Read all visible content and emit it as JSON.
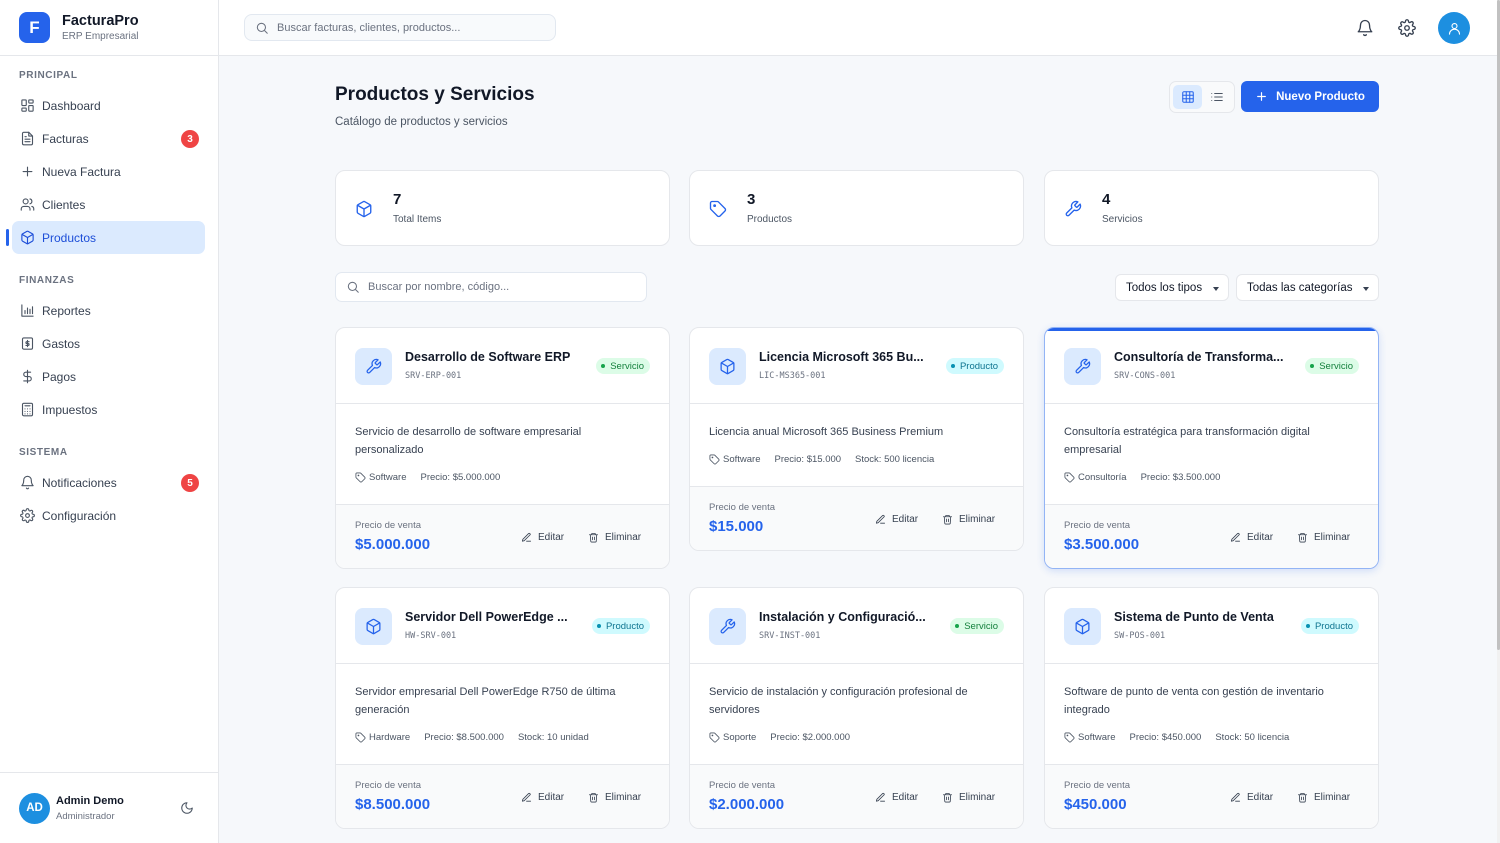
{
  "brand": {
    "logo_letter": "F",
    "name": "FacturaPro",
    "subtitle": "ERP Empresarial"
  },
  "sidebar": {
    "sections": [
      {
        "title": "PRINCIPAL",
        "items": [
          {
            "label": "Dashboard",
            "icon": "grid-icon"
          },
          {
            "label": "Facturas",
            "icon": "file-text-icon",
            "badge": "3"
          },
          {
            "label": "Nueva Factura",
            "icon": "plus-icon"
          },
          {
            "label": "Clientes",
            "icon": "users-icon"
          },
          {
            "label": "Productos",
            "icon": "package-icon",
            "active": true
          }
        ]
      },
      {
        "title": "FINANZAS",
        "items": [
          {
            "label": "Reportes",
            "icon": "bar-chart-icon"
          },
          {
            "label": "Gastos",
            "icon": "receipt-icon"
          },
          {
            "label": "Pagos",
            "icon": "dollar-icon"
          },
          {
            "label": "Impuestos",
            "icon": "calculator-icon"
          }
        ]
      },
      {
        "title": "SISTEMA",
        "items": [
          {
            "label": "Notificaciones",
            "icon": "bell-icon",
            "badge": "5"
          },
          {
            "label": "Configuración",
            "icon": "gear-icon"
          }
        ]
      }
    ],
    "user": {
      "initials": "AD",
      "name": "Admin Demo",
      "role": "Administrador"
    }
  },
  "topbar": {
    "search_placeholder": "Buscar facturas, clientes, productos..."
  },
  "page": {
    "title": "Productos y Servicios",
    "subtitle": "Catálogo de productos y servicios",
    "new_button": "Nuevo Producto"
  },
  "stats": [
    {
      "value": "7",
      "label": "Total Items",
      "icon": "package-icon"
    },
    {
      "value": "3",
      "label": "Productos",
      "icon": "tag-icon"
    },
    {
      "value": "4",
      "label": "Servicios",
      "icon": "wrench-icon"
    }
  ],
  "filters": {
    "search_placeholder": "Buscar por nombre, código...",
    "type_select": "Todos los tipos",
    "category_select": "Todas las categorías"
  },
  "labels": {
    "sale_price": "Precio de venta",
    "edit": "Editar",
    "delete": "Eliminar"
  },
  "products": [
    {
      "name": "Desarrollo de Software ERP",
      "code": "SRV-ERP-001",
      "type": "Servicio",
      "icon": "wrench-icon",
      "description": "Servicio de desarrollo de software empresarial personalizado",
      "category": "Software",
      "price_meta": "Precio: $5.000.000",
      "stock": "",
      "sale_price": "$5.000.000"
    },
    {
      "name": "Licencia Microsoft 365 Bu...",
      "code": "LIC-MS365-001",
      "type": "Producto",
      "icon": "package-icon",
      "description": "Licencia anual Microsoft 365 Business Premium",
      "category": "Software",
      "price_meta": "Precio: $15.000",
      "stock": "Stock: 500 licencia",
      "sale_price": "$15.000"
    },
    {
      "name": "Consultoría de Transforma...",
      "code": "SRV-CONS-001",
      "type": "Servicio",
      "icon": "wrench-icon",
      "description": "Consultoría estratégica para transformación digital empresarial",
      "category": "Consultoría",
      "price_meta": "Precio: $3.500.000",
      "stock": "",
      "sale_price": "$3.500.000"
    },
    {
      "name": "Servidor Dell PowerEdge ...",
      "code": "HW-SRV-001",
      "type": "Producto",
      "icon": "package-icon",
      "description": "Servidor empresarial Dell PowerEdge R750 de última generación",
      "category": "Hardware",
      "price_meta": "Precio: $8.500.000",
      "stock": "Stock: 10 unidad",
      "sale_price": "$8.500.000"
    },
    {
      "name": "Instalación y Configuració...",
      "code": "SRV-INST-001",
      "type": "Servicio",
      "icon": "wrench-icon",
      "description": "Servicio de instalación y configuración profesional de servidores",
      "category": "Soporte",
      "price_meta": "Precio: $2.000.000",
      "stock": "",
      "sale_price": "$2.000.000"
    },
    {
      "name": "Sistema de Punto de Venta",
      "code": "SW-POS-001",
      "type": "Producto",
      "icon": "package-icon",
      "description": "Software de punto de venta con gestión de inventario integrado",
      "category": "Software",
      "price_meta": "Precio: $450.000",
      "stock": "Stock: 50 licencia",
      "sale_price": "$450.000"
    }
  ],
  "colors": {
    "accent": "#2563eb",
    "badge_red": "#ef4444",
    "servicio_green": "#15803d",
    "producto_cyan": "#0e7490"
  }
}
